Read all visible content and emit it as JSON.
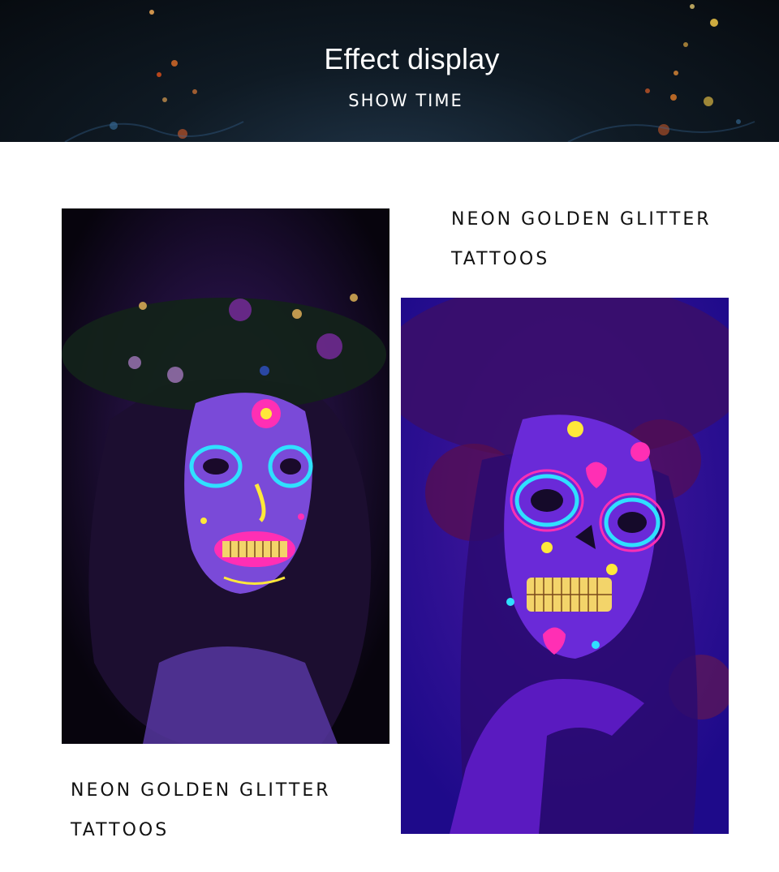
{
  "banner": {
    "title": "Effect display",
    "subtitle": "SHOW TIME"
  },
  "captions": {
    "top": {
      "line1": "NEON GOLDEN GLITTER",
      "line2": "TATTOOS"
    },
    "bottom": {
      "line1": "NEON GOLDEN GLITTER",
      "line2": "TATTOOS"
    }
  },
  "colors": {
    "banner_bg": "#0b121a",
    "page_bg": "#ffffff",
    "caption_text": "#111111",
    "neon_pink": "#ff2fb4",
    "neon_cyan": "#2fe0ff",
    "neon_yellow": "#ffe83a",
    "uv_blue": "#2a0aa8"
  },
  "icons": {
    "left_photo": "uv-sugar-skull-face-flower-crown-image",
    "right_photo": "uv-sugar-skull-face-hand-on-chin-image"
  }
}
